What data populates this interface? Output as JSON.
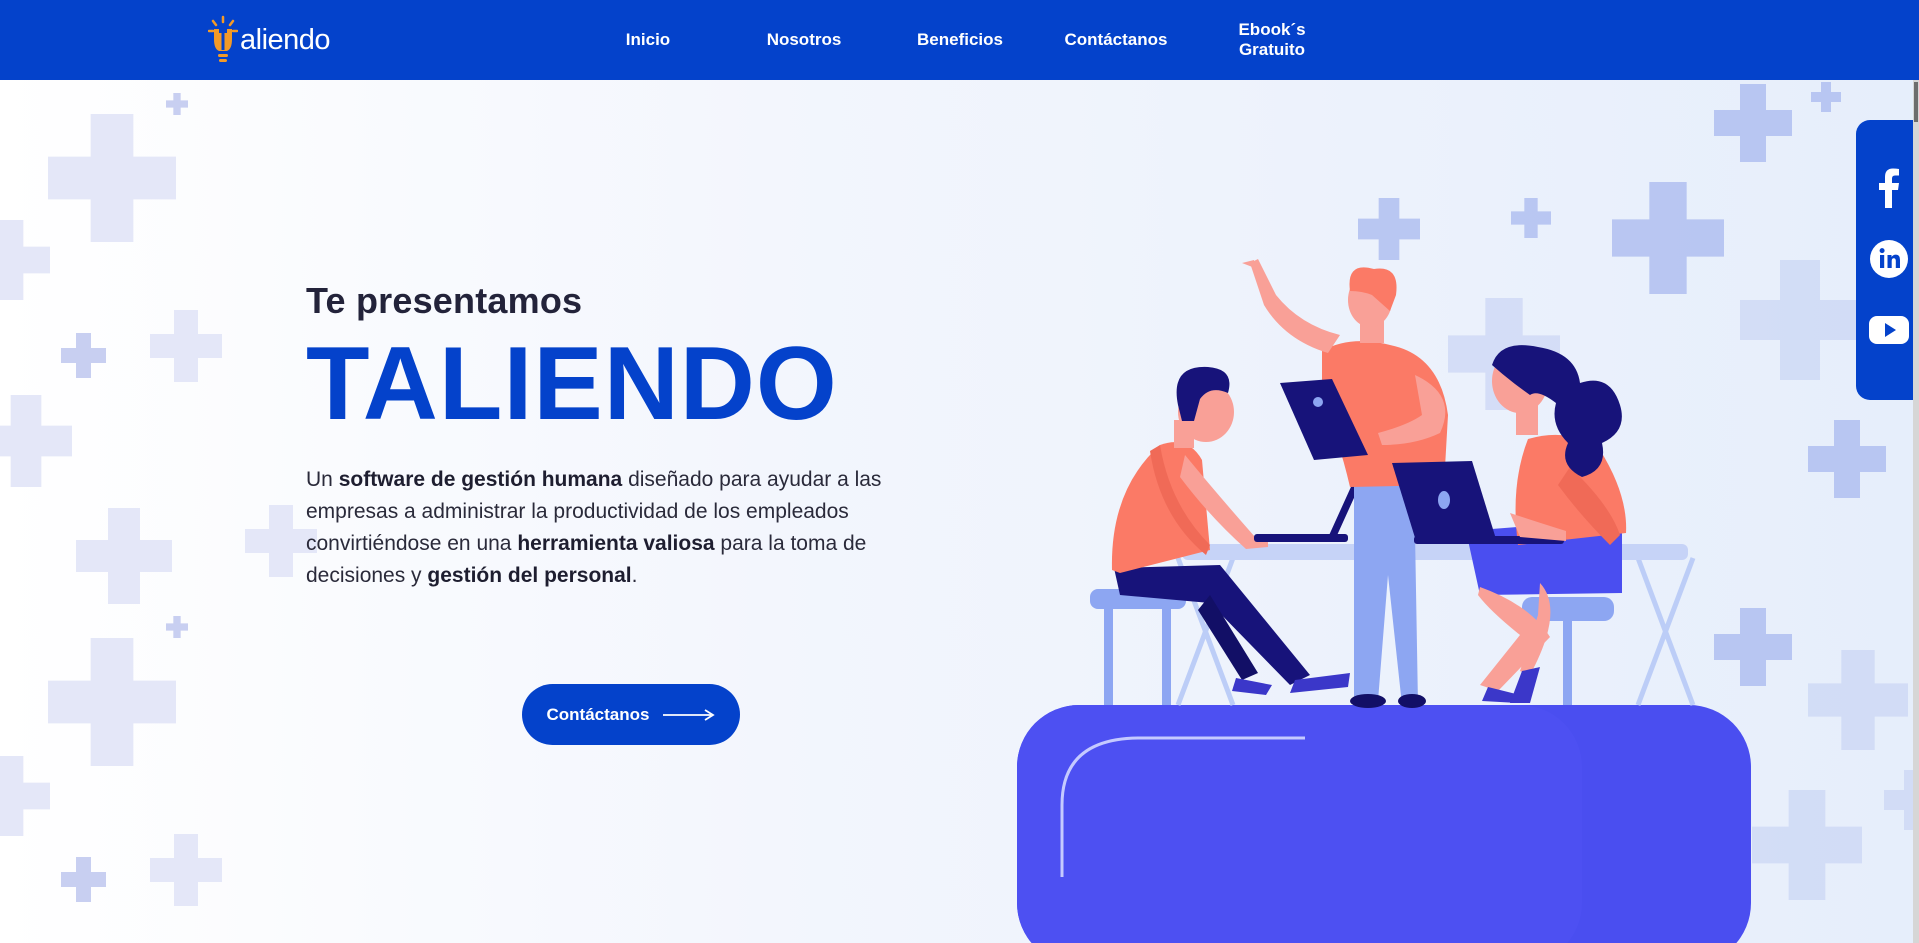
{
  "brand": {
    "logo_text": "aliendo",
    "colors": {
      "primary": "#0442cb",
      "accent": "#f39a28",
      "coral": "#fb7a66",
      "violet": "#4a4ef0"
    }
  },
  "nav": {
    "items": [
      "Inicio",
      "Nosotros",
      "Beneficios",
      "Contáctanos",
      "Ebook´s Gratuito"
    ]
  },
  "hero": {
    "pre_title": "Te presentamos",
    "title": "TALIENDO",
    "desc": {
      "p1": "Un ",
      "b1": "software de gestión humana",
      "p2": " diseñado para ayudar a las empresas a administrar la productividad de los empleados convirtiéndose en una ",
      "b2": "herramienta valiosa",
      "p3": " para la toma de decisiones y ",
      "b3": "gestión del personal",
      "p4": "."
    },
    "cta_label": "Contáctanos"
  },
  "social": {
    "icons": [
      "facebook-icon",
      "linkedin-icon",
      "youtube-icon"
    ]
  }
}
